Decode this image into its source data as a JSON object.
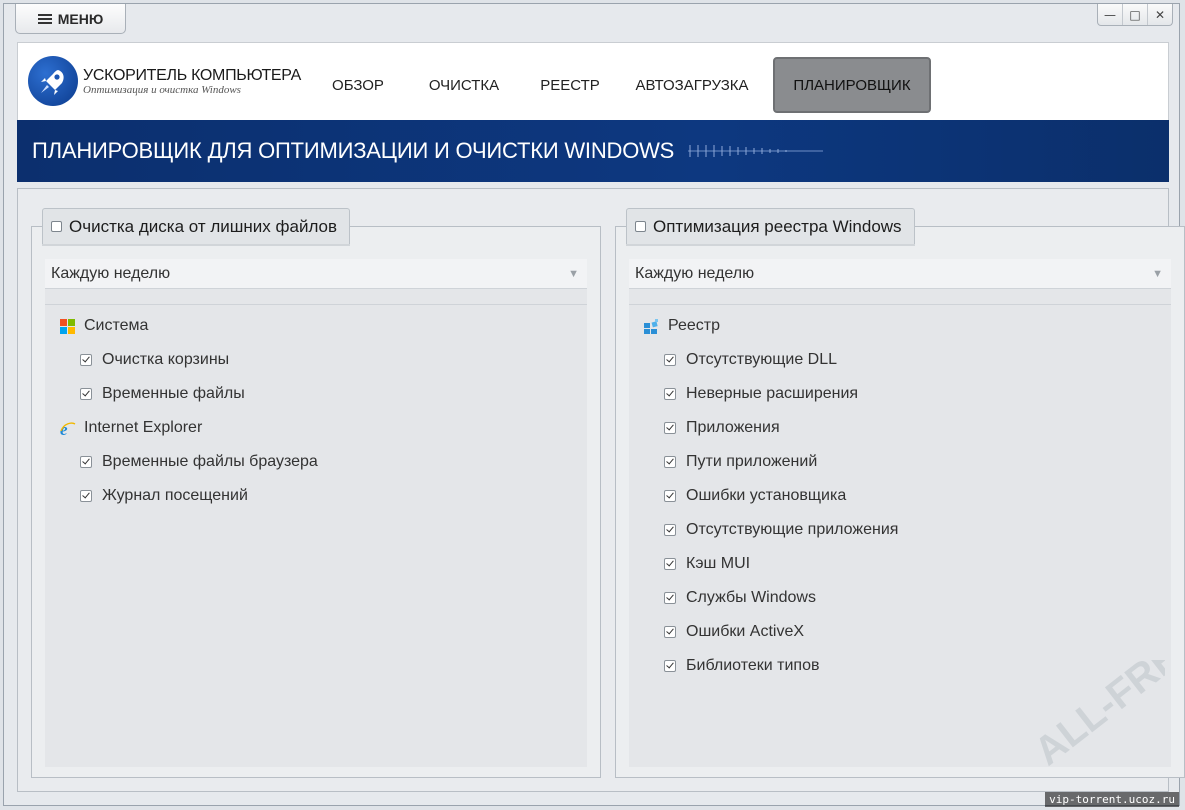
{
  "titlebar": {
    "menu_label": "МЕНЮ",
    "controls": [
      "—",
      "□",
      "✕"
    ]
  },
  "logo": {
    "title": "УСКОРИТЕЛЬ КОМПЬЮТЕРА",
    "subtitle": "Оптимизация и очистка Windows",
    "icon": "rocket-icon"
  },
  "nav": {
    "items": [
      {
        "label": "ОБЗОР",
        "active": false
      },
      {
        "label": "ОЧИСТКА",
        "active": false
      },
      {
        "label": "РЕЕСТР",
        "active": false
      },
      {
        "label": "АВТОЗАГРУЗКА",
        "active": false
      },
      {
        "label": "ПЛАНИРОВЩИК",
        "active": true
      }
    ]
  },
  "banner": {
    "title": "ПЛАНИРОВЩИК ДЛЯ ОПТИМИЗАЦИИ И ОЧИСТКИ WINDOWS"
  },
  "left_panel": {
    "title": "Очистка диска от лишних файлов",
    "enabled": false,
    "schedule": "Каждую неделю",
    "groups": [
      {
        "name": "Система",
        "icon": "windows-logo-icon",
        "items": [
          {
            "label": "Очистка корзины",
            "checked": true
          },
          {
            "label": "Временные файлы",
            "checked": true
          }
        ]
      },
      {
        "name": "Internet Explorer",
        "icon": "internet-explorer-icon",
        "items": [
          {
            "label": "Временные файлы браузера",
            "checked": true
          },
          {
            "label": "Журнал посещений",
            "checked": true
          }
        ]
      }
    ]
  },
  "right_panel": {
    "title": "Оптимизация реестра Windows",
    "enabled": false,
    "schedule": "Каждую неделю",
    "groups": [
      {
        "name": "Реестр",
        "icon": "registry-icon",
        "items": [
          {
            "label": "Отсутствующие DLL",
            "checked": true
          },
          {
            "label": "Неверные расширения",
            "checked": true
          },
          {
            "label": "Приложения",
            "checked": true
          },
          {
            "label": "Пути приложений",
            "checked": true
          },
          {
            "label": "Ошибки установщика",
            "checked": true
          },
          {
            "label": "Отсутствующие приложения",
            "checked": true
          },
          {
            "label": "Кэш MUI",
            "checked": true
          },
          {
            "label": "Службы Windows",
            "checked": true
          },
          {
            "label": "Ошибки ActiveX",
            "checked": true
          },
          {
            "label": "Библиотеки типов",
            "checked": true
          }
        ]
      }
    ]
  },
  "watermark": {
    "text": "ALL-FREE LOAD"
  },
  "footer": {
    "url": "vip-torrent.ucoz.ru"
  },
  "colors": {
    "banner": "#0d3880",
    "active_tab": "#8a8c8f",
    "logo": "#1b55b3"
  }
}
